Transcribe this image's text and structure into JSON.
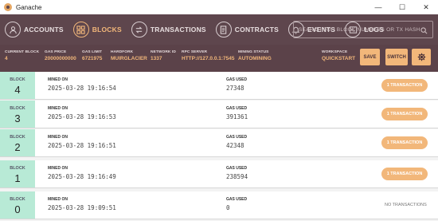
{
  "window": {
    "title": "Ganache"
  },
  "window_controls": {
    "minimize": "—",
    "maximize": "☐",
    "close": "✕"
  },
  "nav": {
    "items": [
      {
        "label": "ACCOUNTS",
        "icon": "accounts-icon"
      },
      {
        "label": "BLOCKS",
        "icon": "blocks-icon",
        "active": true
      },
      {
        "label": "TRANSACTIONS",
        "icon": "transactions-icon"
      },
      {
        "label": "CONTRACTS",
        "icon": "contracts-icon"
      },
      {
        "label": "EVENTS",
        "icon": "events-icon"
      },
      {
        "label": "LOGS",
        "icon": "logs-icon"
      }
    ],
    "search_placeholder": "SEARCH FOR BLOCK NUMBERS OR TX HASHES"
  },
  "status": {
    "current_block_label": "CURRENT BLOCK",
    "current_block": "4",
    "gas_price_label": "GAS PRICE",
    "gas_price": "20000000000",
    "gas_limit_label": "GAS LIMIT",
    "gas_limit": "6721975",
    "hardfork_label": "HARDFORK",
    "hardfork": "MUIRGLACIER",
    "network_id_label": "NETWORK ID",
    "network_id": "1337",
    "rpc_server_label": "RPC SERVER",
    "rpc_server": "HTTP://127.0.0.1:7545",
    "mining_status_label": "MINING STATUS",
    "mining_status": "AUTOMINING",
    "workspace_label": "WORKSPACE",
    "workspace": "QUICKSTART",
    "save_label": "SAVE",
    "switch_label": "SWITCH"
  },
  "colors": {
    "nav_bg": "#5e464d",
    "accent": "#f2b77a",
    "block_cell": "#b8ead6"
  },
  "blocks": [
    {
      "block_label": "BLOCK",
      "number": "4",
      "mined_on_label": "MINED ON",
      "mined_on": "2025-03-28 19:16:54",
      "gas_used_label": "GAS USED",
      "gas_used": "27348",
      "tx": "1 TRANSACTION",
      "has_tx": true
    },
    {
      "block_label": "BLOCK",
      "number": "3",
      "mined_on_label": "MINED ON",
      "mined_on": "2025-03-28 19:16:53",
      "gas_used_label": "GAS USED",
      "gas_used": "391361",
      "tx": "1 TRANSACTION",
      "has_tx": true
    },
    {
      "block_label": "BLOCK",
      "number": "2",
      "mined_on_label": "MINED ON",
      "mined_on": "2025-03-28 19:16:51",
      "gas_used_label": "GAS USED",
      "gas_used": "42348",
      "tx": "1 TRANSACTION",
      "has_tx": true
    },
    {
      "block_label": "BLOCK",
      "number": "1",
      "mined_on_label": "MINED ON",
      "mined_on": "2025-03-28 19:16:49",
      "gas_used_label": "GAS USED",
      "gas_used": "238594",
      "tx": "1 TRANSACTION",
      "has_tx": true
    },
    {
      "block_label": "BLOCK",
      "number": "0",
      "mined_on_label": "MINED ON",
      "mined_on": "2025-03-28 19:09:51",
      "gas_used_label": "GAS USED",
      "gas_used": "0",
      "tx": "NO TRANSACTIONS",
      "has_tx": false
    }
  ]
}
